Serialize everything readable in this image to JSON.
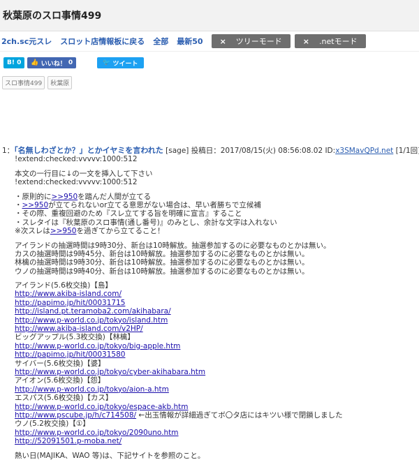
{
  "page": {
    "title": "秋葉原のスロ事情499"
  },
  "nav": {
    "links": [
      "2ch.sc元スレ",
      "スロット店情報板に戻る",
      "全部",
      "最新50"
    ],
    "tree_mode": "ツリーモード",
    "net_mode": ".netモード",
    "close_glyph": "×"
  },
  "share": {
    "hatebu_label": "B!",
    "hatebu_count": "0",
    "fb_label": "いいね！",
    "fb_count": "0",
    "tweet_label": "ツイート"
  },
  "tags": [
    "スロ事情499",
    "秋葉原"
  ],
  "post": {
    "number": "1：",
    "subject": "「名無しわざとか？」とかイヤミを言われた",
    "meta": "[sage] 投稿日：2017/08/15(火) 08:56:08.02 ID:",
    "uid": "x3SMavQPd.net",
    "count": "[1/1回]",
    "l01": "!extend:checked:vvvvv:1000:512",
    "l02": "本文の一行目に↓の一文を挿入して下さい",
    "l03": "!extend:checked:vvvvv:1000:512",
    "l04a": "・原則的に",
    "l04b": ">>950",
    "l04c": "を踏んだ人間が立てる",
    "l05a": "・",
    "l05b": ">>950",
    "l05c": "が立てられないor立てる意思がない場合は、早い者勝ちで立候補",
    "l06": "・その際、重複回避のため『スレ立てする旨を明確に宣言』すること",
    "l07": "・スレタイは『秋葉原のスロ事情(通し番号)』のみとし、余計な文字は入れない",
    "l08a": "※次スレは",
    "l08b": ">>950",
    "l08c": "を過ぎてから立てること！",
    "l09": "アイランドの抽選時間は9時30分、新台は10時解放。抽選参加するのに必要なものとかは無い。",
    "l10": "カスの抽選時間は9時45分、新台は10時解放。抽選参加するのに必要なものとかは無い。",
    "l11": "林檎の抽選時間は9時30分、新台は10時解放。抽選参加するのに必要なものとかは無い。",
    "l12": "ウノの抽選時間は9時40分、新台は10時解放。抽選参加するのに必要なものとかは無い。",
    "l13": "アイランド(5.6枚交換)【島】",
    "l14": "http://www.akiba-island.com/",
    "l15": "http://papimo.jp/hit/00031715",
    "l16": "http://island.pt.teramoba2.com/akihabara/",
    "l17": "http://www.p-world.co.jp/tokyo/island.htm",
    "l18": "http://www.akiba-island.com/v2HP/",
    "l19": "ビッグアップル(5.3枚交換)【林檎】",
    "l20": "http://www.p-world.co.jp/tokyo/big-apple.htm",
    "l21": "http://papimo.jp/hit/00031580",
    "l22": "サイバー(5.6枚交換)【婆】",
    "l23": "http://www.p-world.co.jp/tokyo/cyber-akihabara.htm",
    "l24": "アイオン(5.6枚交換)【怨】",
    "l25": "http://www.p-world.co.jp/tokyo/aion-a.htm",
    "l26": "エスパス(5.6枚交換)【カス】",
    "l27": "http://www.p-world.co.jp/tokyo/espace-akb.htm",
    "l28a": "http://www.pscube.jp/h/c714508/",
    "l28b": "←出玉情報が詳細過ぎてボ〇タ店にはキツい様で閉鎖しました",
    "l29": "ウノ(5.2枚交換)【①】",
    "l30": "http://www.p-world.co.jp/tokyo/2090uno.htm",
    "l31": "http://52091501.p-moba.net/",
    "l32": "熱い日(MAJIKA、WAO 等)は、下記サイトを参照のこと。"
  }
}
